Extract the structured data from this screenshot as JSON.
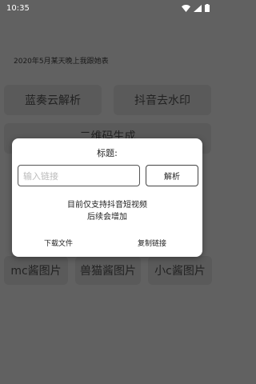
{
  "status_bar": {
    "time": "10:35"
  },
  "headline": "2020年5月某天晚上我跟她表",
  "buttons": {
    "lanzou": "蓝奏云解析",
    "douyin": "抖音去水印",
    "qrcode": "二维码生成",
    "mc": "mc酱图片",
    "shoumao": "兽猫酱图片",
    "xiaoc": "小c酱图片"
  },
  "dialog": {
    "title": "标题:",
    "input_placeholder": "输入链接",
    "parse_button": "解析",
    "message_line1": "目前仅支持抖音短视频",
    "message_line2": "后续会增加",
    "download_button": "下载文件",
    "copy_button": "复制链接"
  }
}
